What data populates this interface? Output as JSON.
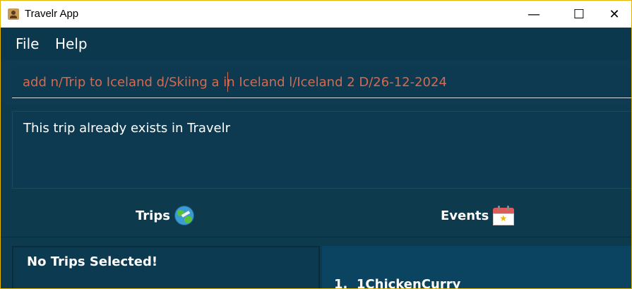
{
  "window": {
    "title": "Travelr App",
    "controls": {
      "minimize": "—",
      "maximize": "☐",
      "close": "✕"
    }
  },
  "menubar": {
    "items": [
      "File",
      "Help"
    ]
  },
  "command": {
    "value": "add n/Trip to Iceland d/Skiing a in Iceland l/Iceland 2 D/26-12-2024"
  },
  "result": {
    "message": "This trip already exists in Travelr"
  },
  "tabs": [
    {
      "label": "Trips",
      "icon": "globe-icon"
    },
    {
      "label": "Events",
      "icon": "calendar-icon"
    }
  ],
  "trips_panel": {
    "empty_message": "No Trips Selected!"
  },
  "events_panel": {
    "items": [
      "1.  1ChickenCurry"
    ]
  }
}
